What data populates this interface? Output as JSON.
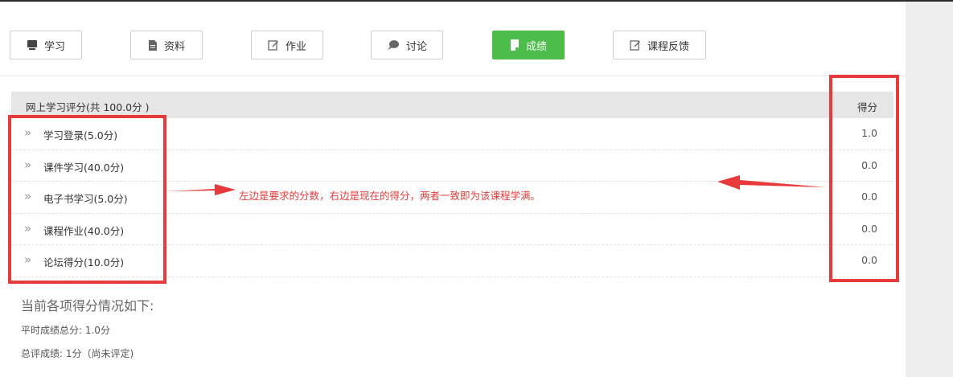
{
  "tabs": [
    {
      "label": "学习",
      "icon": "monitor-icon",
      "active": false
    },
    {
      "label": "资料",
      "icon": "document-icon",
      "active": false
    },
    {
      "label": "作业",
      "icon": "edit-icon",
      "active": false
    },
    {
      "label": "讨论",
      "icon": "chat-bubble-icon",
      "active": false
    },
    {
      "label": "成绩",
      "icon": "report-icon",
      "active": true
    },
    {
      "label": "课程反馈",
      "icon": "edit-icon",
      "active": false
    }
  ],
  "table": {
    "header_label": "网上学习评分(共 100.0分 )",
    "header_score": "得分",
    "rows": [
      {
        "label": "学习登录(5.0分)",
        "score": "1.0"
      },
      {
        "label": "课件学习(40.0分)",
        "score": "0.0"
      },
      {
        "label": "电子书学习(5.0分)",
        "score": "0.0"
      },
      {
        "label": "课程作业(40.0分)",
        "score": "0.0"
      },
      {
        "label": "论坛得分(10.0分)",
        "score": "0.0"
      }
    ],
    "chevron": "»"
  },
  "summary": {
    "title": "当前各项得分情况如下:",
    "regular": "平时成绩总分:  1.0分",
    "final": "总评成绩:  1分（尚未评定)"
  },
  "annotation": {
    "note": "左边是要求的分数，右边是现在的得分，两者一致即为该课程学满。",
    "color": "#e83a3a"
  },
  "colors": {
    "accent": "#4cbd4a",
    "header_bg": "#e6e6e6"
  }
}
